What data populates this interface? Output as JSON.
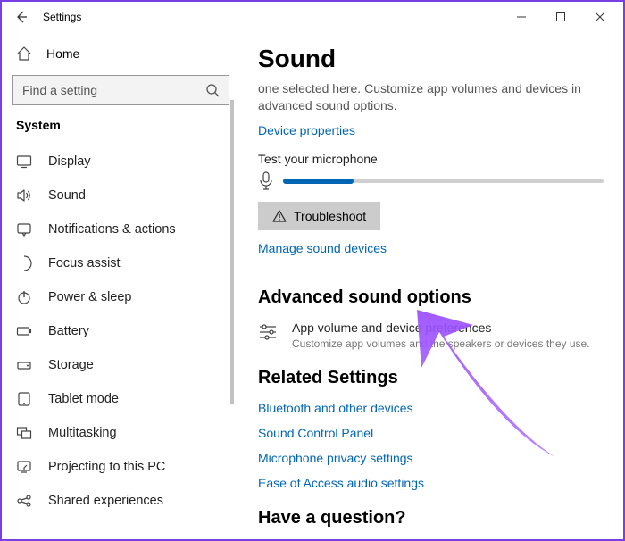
{
  "titlebar": {
    "app_name": "Settings"
  },
  "sidebar": {
    "home_label": "Home",
    "search_placeholder": "Find a setting",
    "category": "System",
    "items": [
      {
        "label": "Display"
      },
      {
        "label": "Sound"
      },
      {
        "label": "Notifications & actions"
      },
      {
        "label": "Focus assist"
      },
      {
        "label": "Power & sleep"
      },
      {
        "label": "Battery"
      },
      {
        "label": "Storage"
      },
      {
        "label": "Tablet mode"
      },
      {
        "label": "Multitasking"
      },
      {
        "label": "Projecting to this PC"
      },
      {
        "label": "Shared experiences"
      }
    ]
  },
  "main": {
    "title": "Sound",
    "desc": "one selected here. Customize app volumes and devices in advanced sound options.",
    "device_properties": "Device properties",
    "test_label": "Test your microphone",
    "mic_level_pct": 22,
    "troubleshoot": "Troubleshoot",
    "manage": "Manage sound devices",
    "advanced_heading": "Advanced sound options",
    "advanced_item_title": "App volume and device preferences",
    "advanced_item_sub": "Customize app volumes and the speakers or devices they use.",
    "related_heading": "Related Settings",
    "related_links": [
      "Bluetooth and other devices",
      "Sound Control Panel",
      "Microphone privacy settings",
      "Ease of Access audio settings"
    ],
    "question_heading": "Have a question?"
  },
  "colors": {
    "link": "#0066b4",
    "accent_border": "#7a3fe4"
  }
}
